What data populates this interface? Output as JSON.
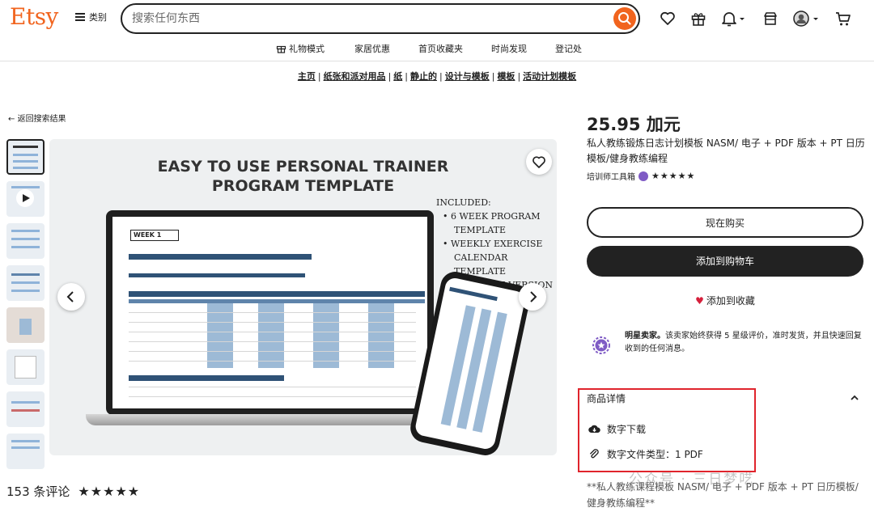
{
  "header": {
    "logo": "Etsy",
    "categories_label": "类别",
    "search_placeholder": "搜索任何东西"
  },
  "subnav": {
    "items": [
      "礼物模式",
      "家居优惠",
      "首页收藏夹",
      "时尚发现",
      "登记处"
    ]
  },
  "breadcrumb": [
    "主页",
    "纸张和派对用品",
    "纸",
    "静止的",
    "设计与模板",
    "模板",
    "活动计划模板"
  ],
  "back_link": "返回搜索结果",
  "gallery": {
    "title_line1": "EASY TO USE PERSONAL TRAINER",
    "title_line2": "PROGRAM TEMPLATE",
    "included_heading": "INCLUDED:",
    "included_items": [
      "6 WEEK PROGRAM",
      "TEMPLATE",
      "WEEKLY EXERCISE",
      "CALENDAR TEMPLATE",
      "PRINTABLE VERSION"
    ],
    "sheet_week": "WEEK 1"
  },
  "reviews": {
    "count_text": "153 条评论",
    "stars": "★★★★★"
  },
  "product": {
    "price": "25.95 加元",
    "title": "私人教练锻炼日志计划模板 NASM/ 电子 + PDF 版本 + PT 日历模板/健身教练编程",
    "shop_name": "培训师工具箱",
    "shop_stars": "★★★★★",
    "buy_now": "现在购买",
    "add_to_cart": "添加到购物车",
    "add_to_favorites": "添加到收藏",
    "star_seller_title": "明星卖家。",
    "star_seller_text": "该卖家始终获得 5 星级评价，准时发货，并且快速回复收到的任何消息。",
    "details_heading": "商品详情",
    "detail_download": "数字下载",
    "detail_filetype": "数字文件类型：1 PDF",
    "description": "**私人教练课程模板 NASM/ 电子 + PDF 版本 + PT 日历模板/健身教练编程**"
  },
  "watermark": "公众号 · 三日梦呓",
  "colors": {
    "brand": "#f1641e",
    "highlight_box": "#e0242c",
    "heart": "#d6203c",
    "star_seller": "#7f5bc5"
  }
}
